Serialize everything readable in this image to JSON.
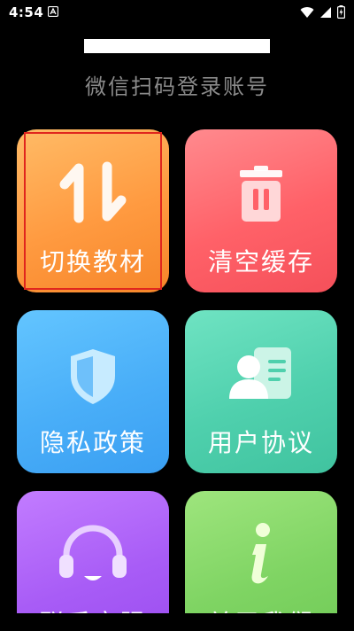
{
  "status_bar": {
    "time": "4:54",
    "notification_icon": "app-notification-icon",
    "icons": [
      "wifi-icon",
      "signal-icon",
      "battery-charging-icon"
    ]
  },
  "header": {
    "subtitle": "微信扫码登录账号"
  },
  "cards": {
    "switch_textbook": {
      "label": "切换教材",
      "icon": "swap-arrows-icon",
      "color": "#ff9a40"
    },
    "clear_cache": {
      "label": "清空缓存",
      "icon": "trash-icon",
      "color": "#ff6168"
    },
    "privacy_policy": {
      "label": "隐私政策",
      "icon": "shield-icon",
      "color": "#49aef8"
    },
    "user_agreement": {
      "label": "用户协议",
      "icon": "id-card-icon",
      "color": "#4fd0ad"
    },
    "contact_service": {
      "label": "联系客服",
      "icon": "headset-icon",
      "color": "#a85cf6"
    },
    "about_us": {
      "label": "关于我们",
      "icon": "info-icon",
      "color": "#7fd463"
    }
  }
}
